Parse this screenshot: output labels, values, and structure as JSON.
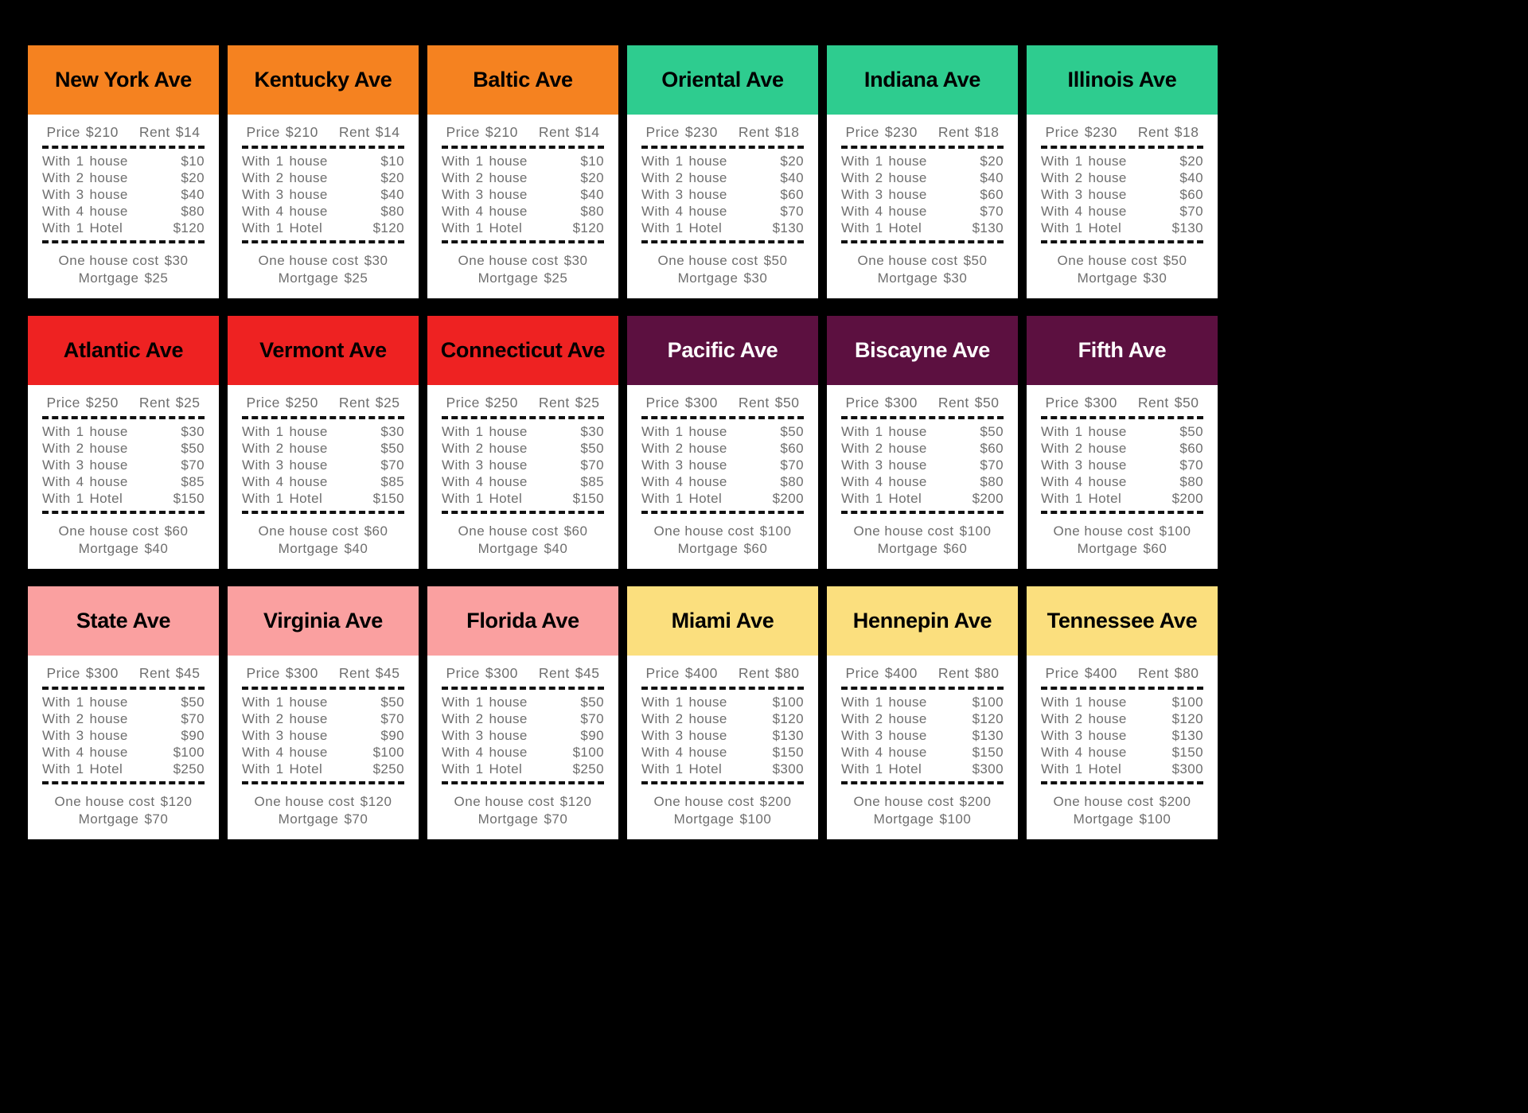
{
  "board": {
    "background_color": "#000000",
    "columns": 6,
    "rows": 3,
    "labels": {
      "price": "Price",
      "rent": "Rent",
      "with": "With",
      "house": "house",
      "hotel": "Hotel",
      "one_house_cost": "One house cost",
      "mortgage": "Mortgage"
    }
  },
  "group_colors": {
    "orange": "#F58220",
    "teal": "#2ECC8F",
    "red": "#EE2222",
    "maroon": "#5C1040",
    "pink": "#FAA0A0",
    "yellow": "#FBDF7E"
  },
  "cards": [
    {
      "name": "New York Ave",
      "group": "orange",
      "header_color": "#F58220",
      "title_color": "#000000",
      "price": "$210",
      "rent": "$14",
      "rents": [
        {
          "count": "1",
          "unit": "house",
          "amount": "$10"
        },
        {
          "count": "2",
          "unit": "house",
          "amount": "$20"
        },
        {
          "count": "3",
          "unit": "house",
          "amount": "$40"
        },
        {
          "count": "4",
          "unit": "house",
          "amount": "$80"
        },
        {
          "count": "1",
          "unit": "Hotel",
          "amount": "$120"
        }
      ],
      "house_cost": "$30",
      "mortgage": "$25"
    },
    {
      "name": "Kentucky Ave",
      "group": "orange",
      "header_color": "#F58220",
      "title_color": "#000000",
      "price": "$210",
      "rent": "$14",
      "rents": [
        {
          "count": "1",
          "unit": "house",
          "amount": "$10"
        },
        {
          "count": "2",
          "unit": "house",
          "amount": "$20"
        },
        {
          "count": "3",
          "unit": "house",
          "amount": "$40"
        },
        {
          "count": "4",
          "unit": "house",
          "amount": "$80"
        },
        {
          "count": "1",
          "unit": "Hotel",
          "amount": "$120"
        }
      ],
      "house_cost": "$30",
      "mortgage": "$25"
    },
    {
      "name": "Baltic Ave",
      "group": "orange",
      "header_color": "#F58220",
      "title_color": "#000000",
      "price": "$210",
      "rent": "$14",
      "rents": [
        {
          "count": "1",
          "unit": "house",
          "amount": "$10"
        },
        {
          "count": "2",
          "unit": "house",
          "amount": "$20"
        },
        {
          "count": "3",
          "unit": "house",
          "amount": "$40"
        },
        {
          "count": "4",
          "unit": "house",
          "amount": "$80"
        },
        {
          "count": "1",
          "unit": "Hotel",
          "amount": "$120"
        }
      ],
      "house_cost": "$30",
      "mortgage": "$25"
    },
    {
      "name": "Oriental Ave",
      "group": "teal",
      "header_color": "#2ECC8F",
      "title_color": "#000000",
      "price": "$230",
      "rent": "$18",
      "rents": [
        {
          "count": "1",
          "unit": "house",
          "amount": "$20"
        },
        {
          "count": "2",
          "unit": "house",
          "amount": "$40"
        },
        {
          "count": "3",
          "unit": "house",
          "amount": "$60"
        },
        {
          "count": "4",
          "unit": "house",
          "amount": "$70"
        },
        {
          "count": "1",
          "unit": "Hotel",
          "amount": "$130"
        }
      ],
      "house_cost": "$50",
      "mortgage": "$30"
    },
    {
      "name": "Indiana Ave",
      "group": "teal",
      "header_color": "#2ECC8F",
      "title_color": "#000000",
      "price": "$230",
      "rent": "$18",
      "rents": [
        {
          "count": "1",
          "unit": "house",
          "amount": "$20"
        },
        {
          "count": "2",
          "unit": "house",
          "amount": "$40"
        },
        {
          "count": "3",
          "unit": "house",
          "amount": "$60"
        },
        {
          "count": "4",
          "unit": "house",
          "amount": "$70"
        },
        {
          "count": "1",
          "unit": "Hotel",
          "amount": "$130"
        }
      ],
      "house_cost": "$50",
      "mortgage": "$30"
    },
    {
      "name": "Illinois Ave",
      "group": "teal",
      "header_color": "#2ECC8F",
      "title_color": "#000000",
      "price": "$230",
      "rent": "$18",
      "rents": [
        {
          "count": "1",
          "unit": "house",
          "amount": "$20"
        },
        {
          "count": "2",
          "unit": "house",
          "amount": "$40"
        },
        {
          "count": "3",
          "unit": "house",
          "amount": "$60"
        },
        {
          "count": "4",
          "unit": "house",
          "amount": "$70"
        },
        {
          "count": "1",
          "unit": "Hotel",
          "amount": "$130"
        }
      ],
      "house_cost": "$50",
      "mortgage": "$30"
    },
    {
      "name": "Atlantic Ave",
      "group": "red",
      "header_color": "#EE2222",
      "title_color": "#000000",
      "price": "$250",
      "rent": "$25",
      "rents": [
        {
          "count": "1",
          "unit": "house",
          "amount": "$30"
        },
        {
          "count": "2",
          "unit": "house",
          "amount": "$50"
        },
        {
          "count": "3",
          "unit": "house",
          "amount": "$70"
        },
        {
          "count": "4",
          "unit": "house",
          "amount": "$85"
        },
        {
          "count": "1",
          "unit": "Hotel",
          "amount": "$150"
        }
      ],
      "house_cost": "$60",
      "mortgage": "$40"
    },
    {
      "name": "Vermont Ave",
      "group": "red",
      "header_color": "#EE2222",
      "title_color": "#000000",
      "price": "$250",
      "rent": "$25",
      "rents": [
        {
          "count": "1",
          "unit": "house",
          "amount": "$30"
        },
        {
          "count": "2",
          "unit": "house",
          "amount": "$50"
        },
        {
          "count": "3",
          "unit": "house",
          "amount": "$70"
        },
        {
          "count": "4",
          "unit": "house",
          "amount": "$85"
        },
        {
          "count": "1",
          "unit": "Hotel",
          "amount": "$150"
        }
      ],
      "house_cost": "$60",
      "mortgage": "$40"
    },
    {
      "name": "Connecticut Ave",
      "group": "red",
      "header_color": "#EE2222",
      "title_color": "#000000",
      "price": "$250",
      "rent": "$25",
      "rents": [
        {
          "count": "1",
          "unit": "house",
          "amount": "$30"
        },
        {
          "count": "2",
          "unit": "house",
          "amount": "$50"
        },
        {
          "count": "3",
          "unit": "house",
          "amount": "$70"
        },
        {
          "count": "4",
          "unit": "house",
          "amount": "$85"
        },
        {
          "count": "1",
          "unit": "Hotel",
          "amount": "$150"
        }
      ],
      "house_cost": "$60",
      "mortgage": "$40"
    },
    {
      "name": "Pacific Ave",
      "group": "maroon",
      "header_color": "#5C1040",
      "title_color": "#FFFFFF",
      "price": "$300",
      "rent": "$50",
      "rents": [
        {
          "count": "1",
          "unit": "house",
          "amount": "$50"
        },
        {
          "count": "2",
          "unit": "house",
          "amount": "$60"
        },
        {
          "count": "3",
          "unit": "house",
          "amount": "$70"
        },
        {
          "count": "4",
          "unit": "house",
          "amount": "$80"
        },
        {
          "count": "1",
          "unit": "Hotel",
          "amount": "$200"
        }
      ],
      "house_cost": "$100",
      "mortgage": "$60"
    },
    {
      "name": "Biscayne Ave",
      "group": "maroon",
      "header_color": "#5C1040",
      "title_color": "#FFFFFF",
      "price": "$300",
      "rent": "$50",
      "rents": [
        {
          "count": "1",
          "unit": "house",
          "amount": "$50"
        },
        {
          "count": "2",
          "unit": "house",
          "amount": "$60"
        },
        {
          "count": "3",
          "unit": "house",
          "amount": "$70"
        },
        {
          "count": "4",
          "unit": "house",
          "amount": "$80"
        },
        {
          "count": "1",
          "unit": "Hotel",
          "amount": "$200"
        }
      ],
      "house_cost": "$100",
      "mortgage": "$60"
    },
    {
      "name": "Fifth Ave",
      "group": "maroon",
      "header_color": "#5C1040",
      "title_color": "#FFFFFF",
      "price": "$300",
      "rent": "$50",
      "rents": [
        {
          "count": "1",
          "unit": "house",
          "amount": "$50"
        },
        {
          "count": "2",
          "unit": "house",
          "amount": "$60"
        },
        {
          "count": "3",
          "unit": "house",
          "amount": "$70"
        },
        {
          "count": "4",
          "unit": "house",
          "amount": "$80"
        },
        {
          "count": "1",
          "unit": "Hotel",
          "amount": "$200"
        }
      ],
      "house_cost": "$100",
      "mortgage": "$60"
    },
    {
      "name": "State Ave",
      "group": "pink",
      "header_color": "#FAA0A0",
      "title_color": "#000000",
      "price": "$300",
      "rent": "$45",
      "rents": [
        {
          "count": "1",
          "unit": "house",
          "amount": "$50"
        },
        {
          "count": "2",
          "unit": "house",
          "amount": "$70"
        },
        {
          "count": "3",
          "unit": "house",
          "amount": "$90"
        },
        {
          "count": "4",
          "unit": "house",
          "amount": "$100"
        },
        {
          "count": "1",
          "unit": "Hotel",
          "amount": "$250"
        }
      ],
      "house_cost": "$120",
      "mortgage": "$70"
    },
    {
      "name": "Virginia Ave",
      "group": "pink",
      "header_color": "#FAA0A0",
      "title_color": "#000000",
      "price": "$300",
      "rent": "$45",
      "rents": [
        {
          "count": "1",
          "unit": "house",
          "amount": "$50"
        },
        {
          "count": "2",
          "unit": "house",
          "amount": "$70"
        },
        {
          "count": "3",
          "unit": "house",
          "amount": "$90"
        },
        {
          "count": "4",
          "unit": "house",
          "amount": "$100"
        },
        {
          "count": "1",
          "unit": "Hotel",
          "amount": "$250"
        }
      ],
      "house_cost": "$120",
      "mortgage": "$70"
    },
    {
      "name": "Florida Ave",
      "group": "pink",
      "header_color": "#FAA0A0",
      "title_color": "#000000",
      "price": "$300",
      "rent": "$45",
      "rents": [
        {
          "count": "1",
          "unit": "house",
          "amount": "$50"
        },
        {
          "count": "2",
          "unit": "house",
          "amount": "$70"
        },
        {
          "count": "3",
          "unit": "house",
          "amount": "$90"
        },
        {
          "count": "4",
          "unit": "house",
          "amount": "$100"
        },
        {
          "count": "1",
          "unit": "Hotel",
          "amount": "$250"
        }
      ],
      "house_cost": "$120",
      "mortgage": "$70"
    },
    {
      "name": "Miami Ave",
      "group": "yellow",
      "header_color": "#FBDF7E",
      "title_color": "#000000",
      "price": "$400",
      "rent": "$80",
      "rents": [
        {
          "count": "1",
          "unit": "house",
          "amount": "$100"
        },
        {
          "count": "2",
          "unit": "house",
          "amount": "$120"
        },
        {
          "count": "3",
          "unit": "house",
          "amount": "$130"
        },
        {
          "count": "4",
          "unit": "house",
          "amount": "$150"
        },
        {
          "count": "1",
          "unit": "Hotel",
          "amount": "$300"
        }
      ],
      "house_cost": "$200",
      "mortgage": "$100"
    },
    {
      "name": "Hennepin Ave",
      "group": "yellow",
      "header_color": "#FBDF7E",
      "title_color": "#000000",
      "price": "$400",
      "rent": "$80",
      "rents": [
        {
          "count": "1",
          "unit": "house",
          "amount": "$100"
        },
        {
          "count": "2",
          "unit": "house",
          "amount": "$120"
        },
        {
          "count": "3",
          "unit": "house",
          "amount": "$130"
        },
        {
          "count": "4",
          "unit": "house",
          "amount": "$150"
        },
        {
          "count": "1",
          "unit": "Hotel",
          "amount": "$300"
        }
      ],
      "house_cost": "$200",
      "mortgage": "$100"
    },
    {
      "name": "Tennessee Ave",
      "group": "yellow",
      "header_color": "#FBDF7E",
      "title_color": "#000000",
      "price": "$400",
      "rent": "$80",
      "rents": [
        {
          "count": "1",
          "unit": "house",
          "amount": "$100"
        },
        {
          "count": "2",
          "unit": "house",
          "amount": "$120"
        },
        {
          "count": "3",
          "unit": "house",
          "amount": "$130"
        },
        {
          "count": "4",
          "unit": "house",
          "amount": "$150"
        },
        {
          "count": "1",
          "unit": "Hotel",
          "amount": "$300"
        }
      ],
      "house_cost": "$200",
      "mortgage": "$100"
    }
  ]
}
